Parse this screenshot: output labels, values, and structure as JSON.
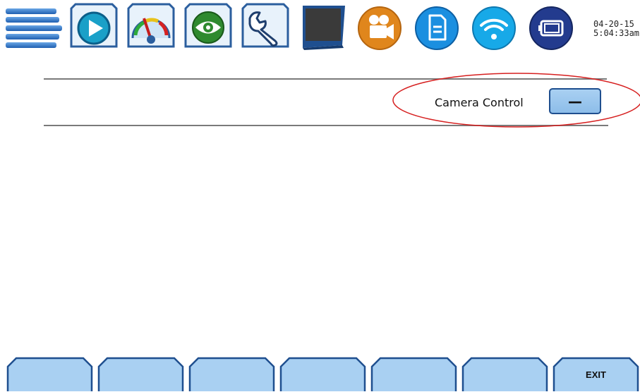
{
  "toolbar": {
    "items": [
      {
        "name": "menu-icon"
      },
      {
        "name": "play-icon"
      },
      {
        "name": "gauge-icon"
      },
      {
        "name": "eye-icon"
      },
      {
        "name": "wrench-icon"
      },
      {
        "name": "monitor-icon"
      },
      {
        "name": "video-camera-icon"
      },
      {
        "name": "document-icon"
      },
      {
        "name": "wifi-icon"
      },
      {
        "name": "battery-icon"
      }
    ]
  },
  "datetime": {
    "date": "04-20-15",
    "time": "5:04:33am"
  },
  "camera_control": {
    "label": "Camera Control",
    "button_label": "—"
  },
  "function_keys": [
    {
      "label": ""
    },
    {
      "label": ""
    },
    {
      "label": ""
    },
    {
      "label": ""
    },
    {
      "label": ""
    },
    {
      "label": ""
    },
    {
      "label": "EXIT"
    }
  ],
  "colors": {
    "accent_blue": "#2b6cb8",
    "key_fill": "#a9d0f2",
    "highlight_red": "#d61f1f",
    "orange": "#e0861c"
  }
}
